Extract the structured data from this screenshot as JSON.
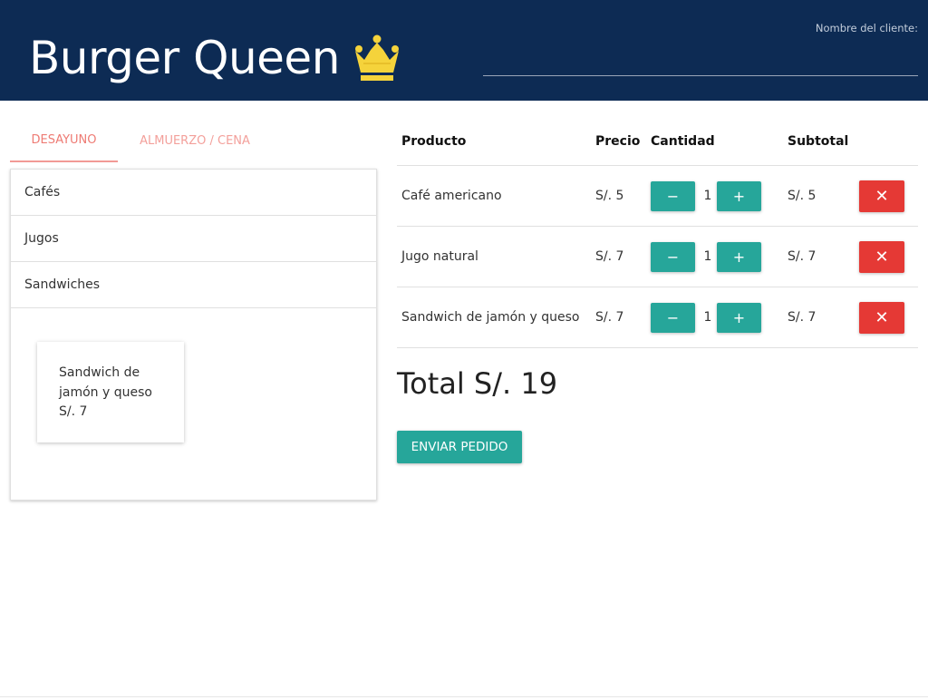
{
  "header": {
    "title": "Burger Queen",
    "logo_icon": "crown-icon",
    "client_label": "Nombre del cliente:",
    "client_value": ""
  },
  "tabs": [
    {
      "label": "DESAYUNO",
      "active": true
    },
    {
      "label": "ALMUERZO / CENA",
      "active": false
    }
  ],
  "menu": {
    "categories": [
      "Cafés",
      "Jugos",
      "Sandwiches"
    ],
    "product": {
      "name_line1": "Sandwich de",
      "name_line2": "jamón y queso",
      "price": "S/. 7"
    }
  },
  "order": {
    "headers": {
      "product": "Producto",
      "price": "Precio",
      "quantity": "Cantidad",
      "subtotal": "Subtotal"
    },
    "rows": [
      {
        "product": "Café americano",
        "price": "S/. 5",
        "quantity": "1",
        "subtotal": "S/. 5"
      },
      {
        "product": "Jugo natural",
        "price": "S/. 7",
        "quantity": "1",
        "subtotal": "S/. 7"
      },
      {
        "product": "Sandwich de jamón y queso",
        "price": "S/. 7",
        "quantity": "1",
        "subtotal": "S/. 7"
      }
    ],
    "minus_label": "−",
    "plus_label": "+",
    "delete_label": "✕",
    "total": "Total S/. 19",
    "send_label": "ENVIAR PEDIDO"
  },
  "colors": {
    "header_bg": "#0d2b54",
    "accent": "#26a69a",
    "danger": "#e53935",
    "tab_active": "#ee7b74",
    "crown": "#f5d33b"
  }
}
